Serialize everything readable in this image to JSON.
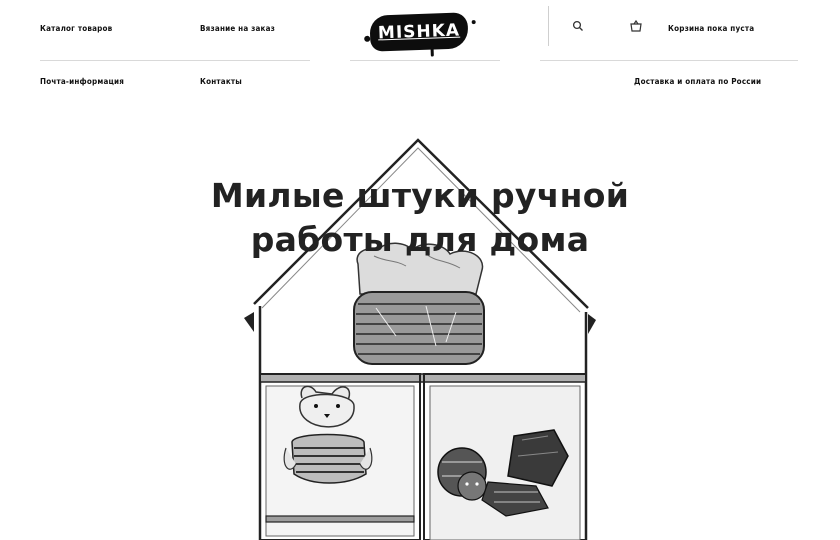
{
  "header": {
    "logo_text": "MISHKA",
    "nav_top_left": [
      "Каталог товаров",
      "Вязание на заказ"
    ],
    "nav_bottom_left": [
      "Почта-информация",
      "Контакты"
    ],
    "nav_top_right": "Корзина пока пуста",
    "nav_bottom_right": "Доставка и оплата по России",
    "icons": [
      "search-icon",
      "cart-icon"
    ]
  },
  "hero": {
    "title_line1": "Милые штуки ручной",
    "title_line2": "работы для дома"
  },
  "colors": {
    "background": "#ffffff",
    "text": "#111111",
    "logo_bg": "#0d0d0d"
  }
}
